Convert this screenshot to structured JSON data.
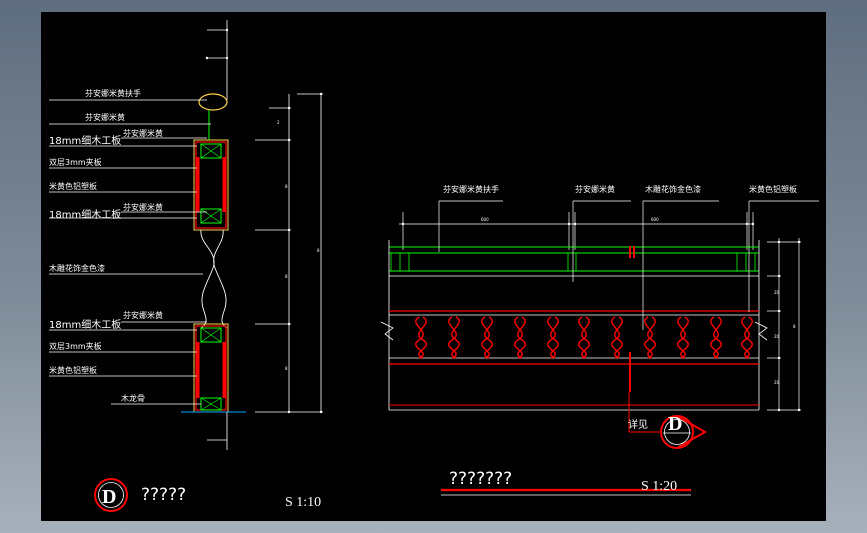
{
  "left_section": {
    "labels": {
      "handrail": "芬安娜米黄扶手",
      "stone_upper": "芬安娜米黄",
      "plywood_upper": "18mm细木工板",
      "stone_upper2": "芬安娜米黄",
      "board_upper": "双层3mm夹板",
      "beige_upper": "米黄色铝塑板",
      "plywood_mid": "18mm细木工板",
      "stone_mid": "芬安娜米黄",
      "wood_flower": "木雕花饰金色漆",
      "plywood_lower": "18mm细木工板",
      "stone_lower": "芬安娜米黄",
      "board_lower": "双层3mm夹板",
      "beige_lower": "米黄色铝塑板",
      "keel": "木龙骨"
    },
    "detail_marker": "D",
    "title": "?????",
    "scale": "S 1:10"
  },
  "right_section": {
    "labels": {
      "handrail": "芬安娜米黄扶手",
      "stone": "芬安娜米黄",
      "wood_flower": "木雕花饰金色漆",
      "beige": "米黄色铝塑板"
    },
    "detail_label": "详见",
    "detail_marker": "D",
    "title": "???????",
    "scale": "S 1:20"
  },
  "colors": {
    "background": "#000000",
    "red": "#ff0000",
    "green": "#00ff00",
    "white": "#ffffff",
    "yellow": "#ffd24a"
  }
}
